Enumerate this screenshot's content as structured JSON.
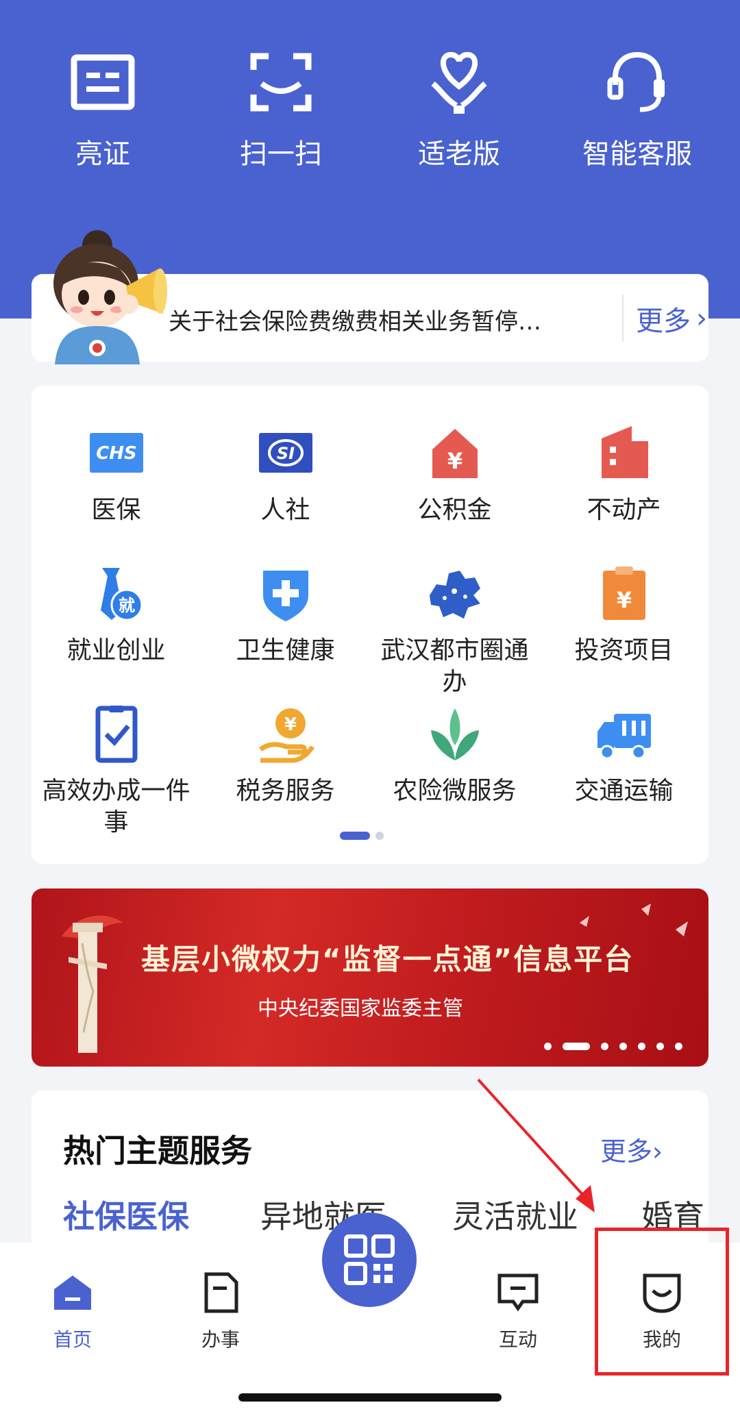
{
  "quick_actions": [
    {
      "label": "亮证",
      "icon": "id-card-icon"
    },
    {
      "label": "扫一扫",
      "icon": "scan-icon"
    },
    {
      "label": "适老版",
      "icon": "elderly-care-icon"
    },
    {
      "label": "智能客服",
      "icon": "headset-icon"
    }
  ],
  "notice": {
    "text": "关于社会保险费缴费相关业务暂停…",
    "more_label": "更多",
    "more_icon": "chevron-right-icon"
  },
  "services": [
    {
      "label": "医保",
      "icon": "chs-icon",
      "color": "#3d8ef0"
    },
    {
      "label": "人社",
      "icon": "si-icon",
      "color": "#2f4fbf"
    },
    {
      "label": "公积金",
      "icon": "house-yuan-icon",
      "color": "#e55a50"
    },
    {
      "label": "不动产",
      "icon": "building-icon",
      "color": "#e55a50"
    },
    {
      "label": "就业创业",
      "icon": "tie-icon",
      "color": "#2f7ee8"
    },
    {
      "label": "卫生健康",
      "icon": "health-shield-icon",
      "color": "#3d8ef0"
    },
    {
      "label": "武汉都市圈通办",
      "icon": "map-icon",
      "color": "#2f5ec8"
    },
    {
      "label": "投资项目",
      "icon": "clipboard-yuan-icon",
      "color": "#f08a3a"
    },
    {
      "label": "高效办成一件事",
      "icon": "checklist-icon",
      "color": "#3157c9"
    },
    {
      "label": "税务服务",
      "icon": "coin-hand-icon",
      "color": "#f0a830"
    },
    {
      "label": "农险微服务",
      "icon": "sprout-icon",
      "color": "#3ea87a"
    },
    {
      "label": "交通运输",
      "icon": "truck-icon",
      "color": "#3d8ef0"
    }
  ],
  "banner": {
    "title": "基层小微权力“监督一点通”信息平台",
    "subtitle": "中央纪委国家监委主管"
  },
  "topics": {
    "title": "热门主题服务",
    "more_label": "更多›",
    "tabs": [
      "社保医保",
      "异地就医",
      "灵活就业",
      "婚育"
    ]
  },
  "bottom_nav": [
    {
      "label": "首页",
      "icon": "home-icon",
      "active": true
    },
    {
      "label": "办事",
      "icon": "document-icon",
      "active": false
    },
    {
      "label": "互动",
      "icon": "chat-icon",
      "active": false
    },
    {
      "label": "我的",
      "icon": "smile-icon",
      "active": false
    }
  ],
  "center_button_icon": "qr-code-icon",
  "colors": {
    "primary": "#4a62cf",
    "highlight": "#e8242a"
  }
}
